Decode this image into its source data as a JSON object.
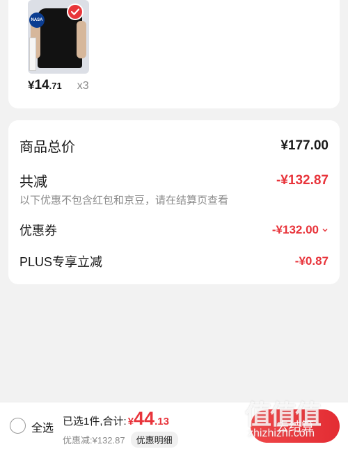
{
  "product": {
    "thumb_logo_text": "NASA",
    "price_symbol": "¥",
    "price_int": "14",
    "price_dec": ".71",
    "quantity": "x3"
  },
  "summary": {
    "total_label": "商品总价",
    "total_value": "¥177.00",
    "reduce_label": "共减",
    "reduce_value": "-¥132.87",
    "note": "以下优惠不包含红包和京豆，请在结算页查看",
    "coupon_label": "优惠券",
    "coupon_value": "-¥132.00",
    "plus_label": "PLUS专享立减",
    "plus_value": "-¥0.87"
  },
  "bottom": {
    "select_all": "全选",
    "selected_text": "已选1件,合计:",
    "total_symbol": "¥",
    "total_int": "44",
    "total_dec": ".13",
    "discount_text": "优惠减:¥132.87",
    "detail_button": "优惠明细",
    "checkout_button": "去结算"
  },
  "watermark": {
    "top": "值值值",
    "bottom": "zhizhizhi.com"
  }
}
